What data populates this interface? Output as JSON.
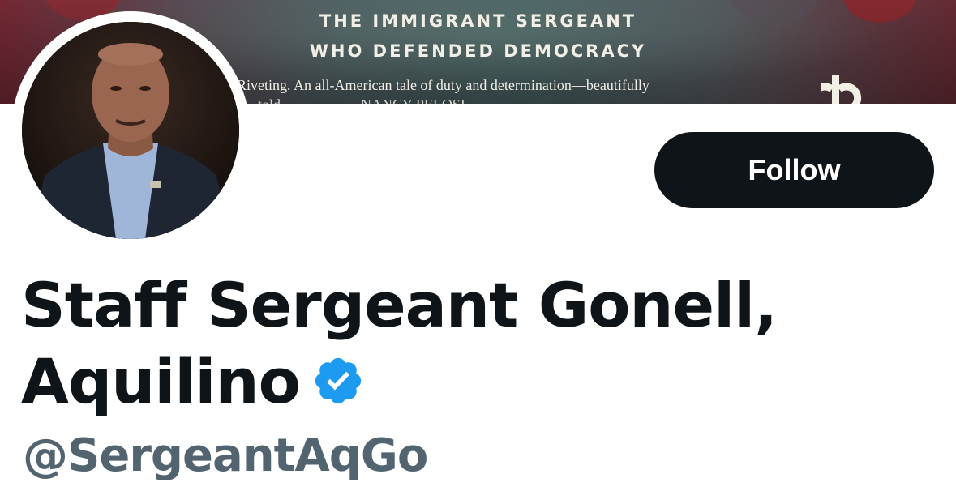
{
  "banner": {
    "title_line1": "THE IMMIGRANT SERGEANT",
    "title_line2": "WHO DEFENDED DEMOCRACY",
    "blurb_line1": "Riveting. An all-American tale of duty and determination—beautifully",
    "blurb_line2": "…told …………… NANCY PELOSI",
    "publisher_icon": "publisher-logo-icon",
    "colors": {
      "accent_red": "#8a2f38",
      "teal": "#4b6466",
      "text": "#f2efe6"
    }
  },
  "profile": {
    "avatar_icon": "profile-photo",
    "name_line1": "Staff Sergeant Gonell,",
    "name_line2": "Aquilino",
    "verified_icon": "verified-badge-icon",
    "handle": "@SergeantAqGo"
  },
  "actions": {
    "follow_label": "Follow"
  },
  "colors": {
    "primary_text": "#0f1419",
    "secondary_text": "#536471",
    "verified_blue": "#1d9bf0",
    "button_bg": "#0f1419",
    "button_text": "#ffffff"
  }
}
